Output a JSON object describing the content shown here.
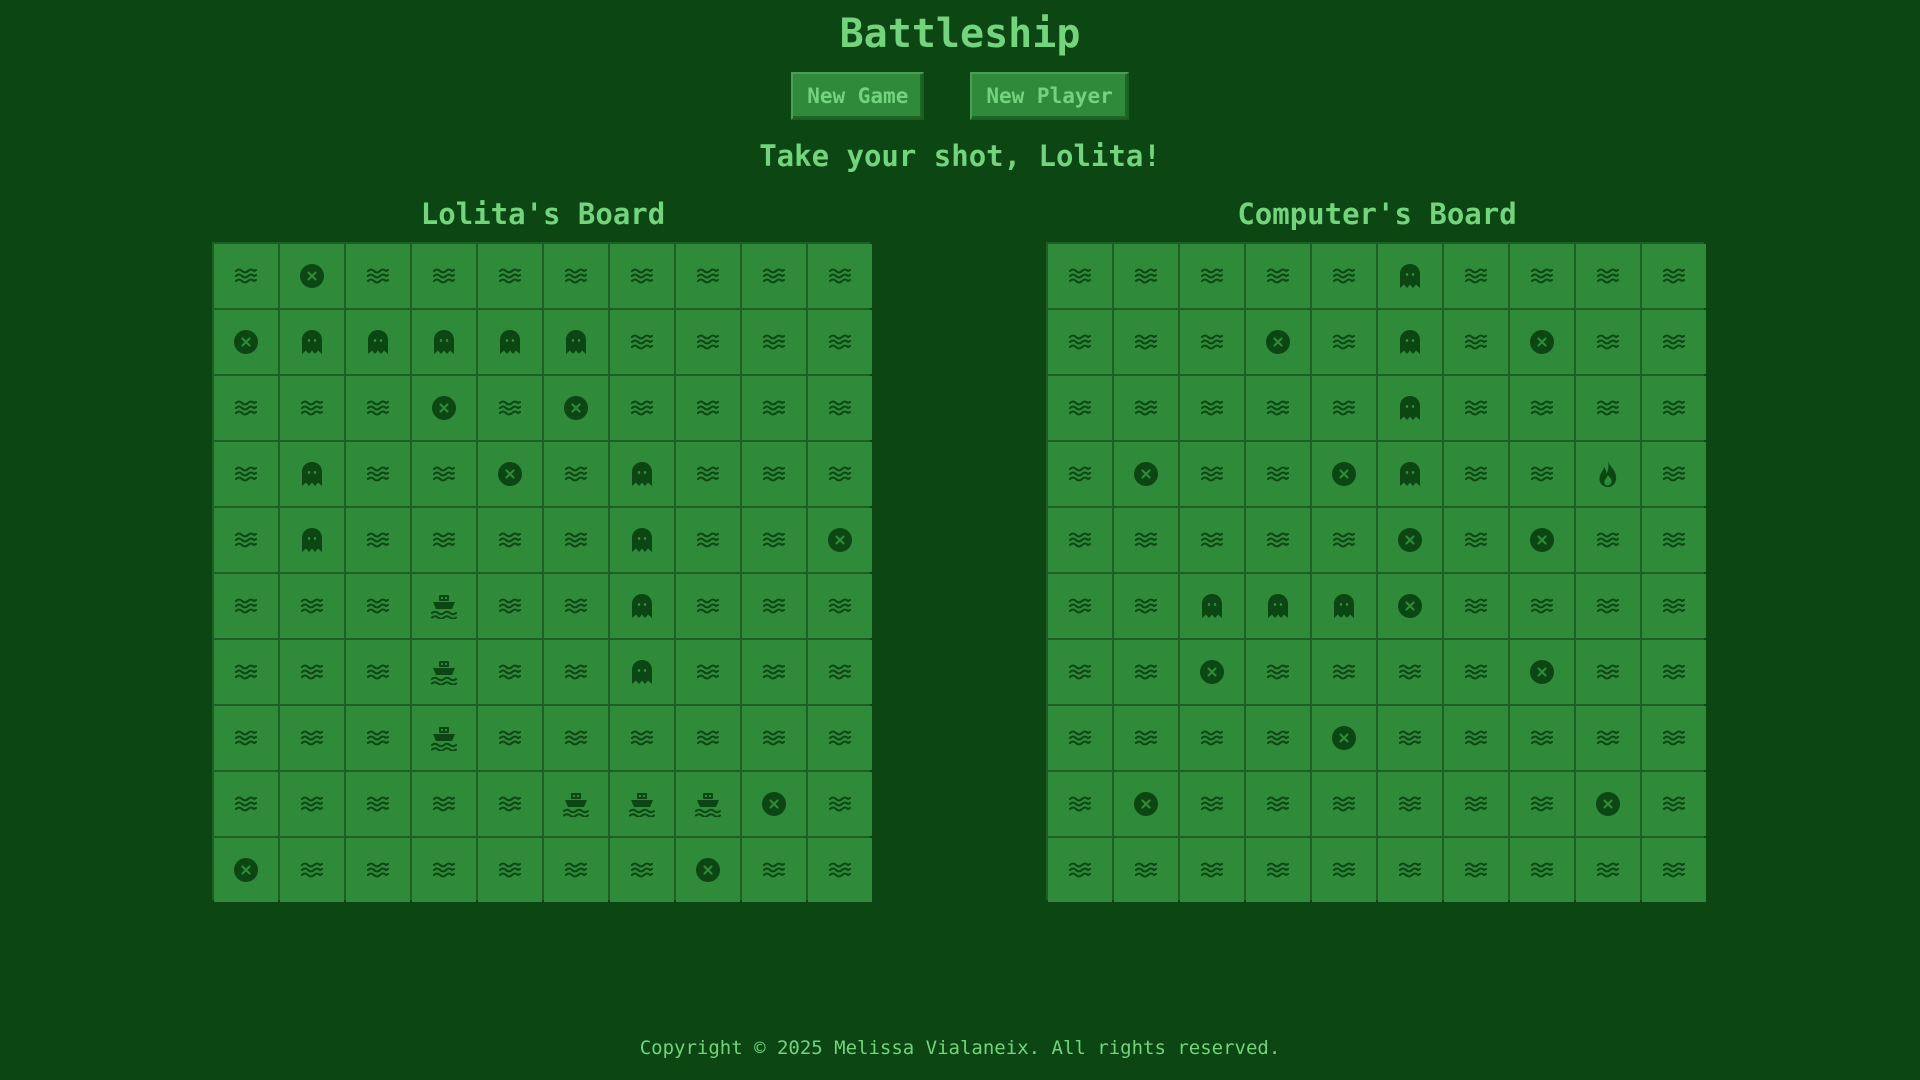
{
  "title": "Battleship",
  "buttons": {
    "new_game": "New Game",
    "new_player": "New Player"
  },
  "status": "Take your shot, Lolita!",
  "colors": {
    "background": "#0b4613",
    "cell": "#2f8a3a",
    "grid_line": "#1d5f25",
    "icon": "#0b4613",
    "text": "#74d37d"
  },
  "legend": {
    "W": "water-icon",
    "M": "miss-icon",
    "G": "ghost-icon",
    "S": "ship-icon",
    "F": "fire-icon"
  },
  "player_board": {
    "title": "Lolita's Board",
    "rows": [
      "WMWWWWWWWW",
      "MGGGGGWWWW",
      "WWWMWMWWWW",
      "WGWWMWGWWW",
      "WGWWWWGWWM",
      "WWWSWWGWWW",
      "WWWSWWGWWW",
      "WWWSWWWWWW",
      "WWWWWSSSMW",
      "MWWWWWWMWW"
    ]
  },
  "computer_board": {
    "title": "Computer's Board",
    "rows": [
      "WWWWWGWWWW",
      "WWWMWGWMWW",
      "WWWWWGWWWW",
      "WMWWMGWWFW",
      "WWWWWMWMWW",
      "WWGGGMWWWW",
      "WWMWWWWMWW",
      "WWWWMWWWWW",
      "WMWWWWWWMW",
      "WWWWWWWWWW"
    ]
  },
  "footer": "Copyright © 2025 Melissa Vialaneix. All rights reserved."
}
